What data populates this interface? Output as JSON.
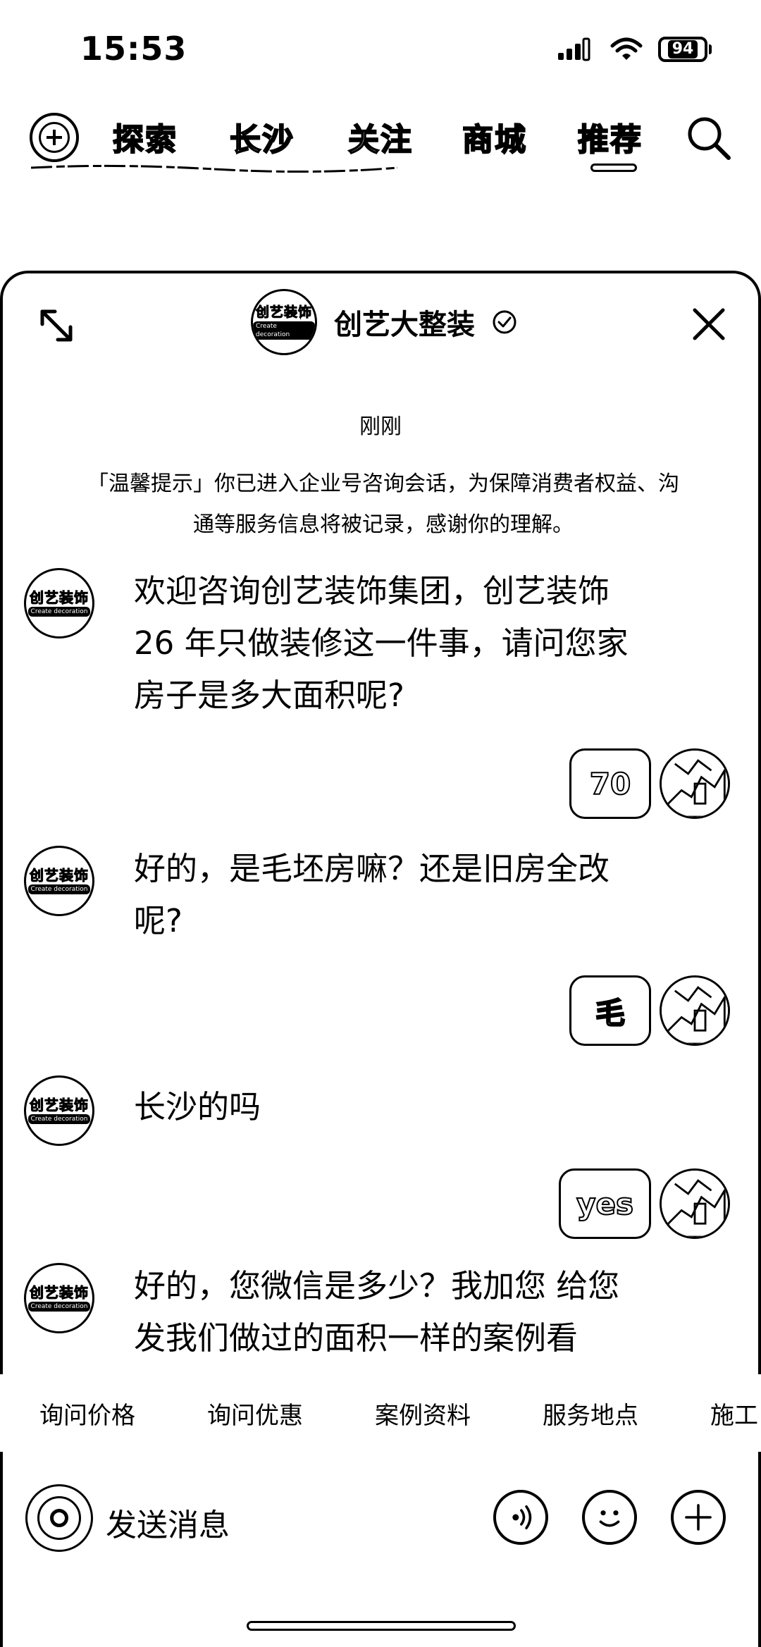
{
  "status_bar": {
    "time": "15:53",
    "battery": "94"
  },
  "top_nav": {
    "tabs": [
      {
        "label": "探索"
      },
      {
        "label": "长沙"
      },
      {
        "label": "关注"
      },
      {
        "label": "商城"
      },
      {
        "label": "推荐"
      }
    ],
    "active_tab": "推荐"
  },
  "chat": {
    "title": "创艺大整装",
    "logo_text": "创艺装饰",
    "logo_subtext": "Create decoration",
    "timestamp": "刚刚",
    "notice": "「温馨提示」你已进入企业号咨询会话，为保障消费者权益、沟通等服务信息将被记录，感谢你的理解。",
    "messages": [
      {
        "from": "business",
        "text": "欢迎咨询创艺装饰集团，创艺装饰 26 年只做装修这一件事，请问您家房子是多大面积呢?"
      },
      {
        "from": "user",
        "text": "70"
      },
      {
        "from": "business",
        "text": "好的，是毛坯房嘛？还是旧房全改呢?"
      },
      {
        "from": "user",
        "text": "毛"
      },
      {
        "from": "business",
        "text": "长沙的吗"
      },
      {
        "from": "user",
        "text": "yes"
      },
      {
        "from": "business",
        "text": "好的，您微信是多少？我加您 给您发我们做过的面积一样的案例看看，把价格用材清单具体发给"
      }
    ]
  },
  "quick_replies": [
    "询问价格",
    "询问优惠",
    "案例资料",
    "服务地点",
    "施工"
  ],
  "input": {
    "placeholder": "发送消息"
  }
}
